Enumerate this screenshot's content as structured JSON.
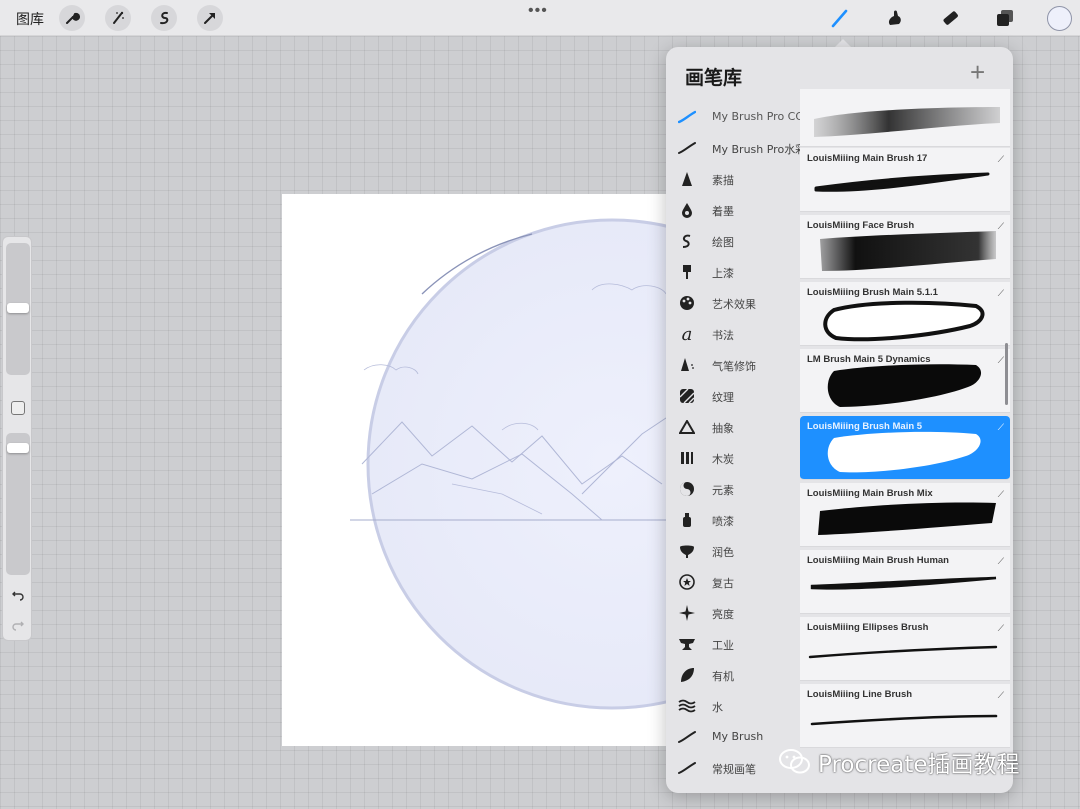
{
  "topbar": {
    "gallery_label": "图库",
    "left_tools": [
      "wrench-icon",
      "magic-wand-icon",
      "selection-icon",
      "transform-arrow-icon"
    ],
    "more_label": "•••",
    "right_tools": [
      "brush-icon",
      "smudge-icon",
      "eraser-icon",
      "layers-icon"
    ],
    "active_tool": "brush-icon",
    "current_color": "#eef0fb"
  },
  "brush_library": {
    "title": "画笔库",
    "add_label": "+",
    "sets": [
      {
        "label": "My Brush Pro CG",
        "icon": "stroke-blue-icon",
        "active": true
      },
      {
        "label": "My Brush Pro水彩",
        "icon": "stroke-icon"
      },
      {
        "label": "素描",
        "icon": "pencil-tip-icon"
      },
      {
        "label": "着墨",
        "icon": "ink-drop-icon"
      },
      {
        "label": "绘图",
        "icon": "squiggle-icon"
      },
      {
        "label": "上漆",
        "icon": "paint-brush-icon"
      },
      {
        "label": "艺术效果",
        "icon": "palette-icon"
      },
      {
        "label": "书法",
        "icon": "calligraphy-icon"
      },
      {
        "label": "气笔修饰",
        "icon": "airbrush-icon"
      },
      {
        "label": "纹理",
        "icon": "texture-icon"
      },
      {
        "label": "抽象",
        "icon": "triangle-icon"
      },
      {
        "label": "木炭",
        "icon": "charcoal-icon"
      },
      {
        "label": "元素",
        "icon": "yin-yang-icon"
      },
      {
        "label": "喷漆",
        "icon": "spray-can-icon"
      },
      {
        "label": "润色",
        "icon": "bell-icon"
      },
      {
        "label": "复古",
        "icon": "star-badge-icon"
      },
      {
        "label": "亮度",
        "icon": "sparkle-icon"
      },
      {
        "label": "工业",
        "icon": "anvil-icon"
      },
      {
        "label": "有机",
        "icon": "leaf-icon"
      },
      {
        "label": "水",
        "icon": "waves-icon"
      },
      {
        "label": "My Brush",
        "icon": "stroke-icon"
      },
      {
        "label": "常规画笔",
        "icon": "stroke-icon"
      }
    ],
    "brushes": [
      {
        "name": "",
        "stroke": "airbrush-dark"
      },
      {
        "name": "LouisMiiing Main Brush 17",
        "stroke": "taper"
      },
      {
        "name": "LouisMiiing Face Brush",
        "stroke": "soft-block"
      },
      {
        "name": "LouisMiiing Brush Main 5.1.1",
        "stroke": "outline-blob"
      },
      {
        "name": "LM Brush Main 5 Dynamics",
        "stroke": "solid-blob"
      },
      {
        "name": "LouisMiiing Brush Main 5",
        "stroke": "white-blob",
        "selected": true
      },
      {
        "name": "LouisMiiing Main Brush Mix",
        "stroke": "wide-band"
      },
      {
        "name": "LouisMiiing Main Brush Human",
        "stroke": "thin-taper"
      },
      {
        "name": "LouisMiiing Ellipses Brush",
        "stroke": "thin-line"
      },
      {
        "name": "LouisMiiing Line Brush",
        "stroke": "thin-line-2"
      }
    ]
  },
  "watermark": {
    "text": "Procreate插画教程"
  }
}
